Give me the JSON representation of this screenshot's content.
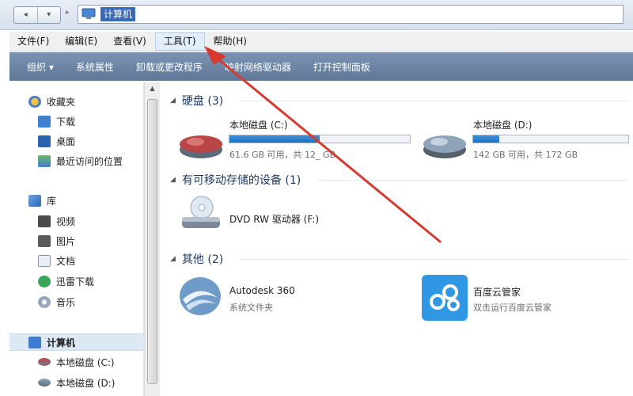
{
  "address": {
    "back_label": "◂",
    "fwd_label": "▾",
    "path": "计算机"
  },
  "menu": [
    {
      "label": "文件(F)"
    },
    {
      "label": "编辑(E)"
    },
    {
      "label": "查看(V)"
    },
    {
      "label": "工具(T)"
    },
    {
      "label": "帮助(H)"
    }
  ],
  "toolbar": [
    {
      "label": "组织 ▾"
    },
    {
      "label": "系统属性"
    },
    {
      "label": "卸载或更改程序"
    },
    {
      "label": "映射网络驱动器"
    },
    {
      "label": "打开控制面板"
    }
  ],
  "sidebar": {
    "favorites": {
      "label": "收藏夹",
      "items": [
        {
          "label": "下载"
        },
        {
          "label": "桌面"
        },
        {
          "label": "最近访问的位置"
        }
      ]
    },
    "libraries": {
      "label": "库",
      "items": [
        {
          "label": "视频"
        },
        {
          "label": "图片"
        },
        {
          "label": "文档"
        },
        {
          "label": "迅雷下载"
        },
        {
          "label": "音乐"
        }
      ]
    },
    "computer": {
      "label": "计算机",
      "items": [
        {
          "label": "本地磁盘 (C:)"
        },
        {
          "label": "本地磁盘 (D:)"
        }
      ]
    }
  },
  "groups": {
    "hdd": {
      "title": "硬盘 (3)",
      "drives": [
        {
          "name": "本地磁盘 (C:)",
          "free": "61.6 GB 可用，共 12_ GB",
          "usage": 0.5
        },
        {
          "name": "本地磁盘 (D:)",
          "free": "142 GB 可用，共 172 GB",
          "usage": 0.17
        }
      ]
    },
    "removable": {
      "title": "有可移动存储的设备 (1)",
      "items": [
        {
          "name": "DVD RW 驱动器 (F:)"
        }
      ]
    },
    "other": {
      "title": "其他 (2)",
      "items": [
        {
          "name": "Autodesk 360",
          "desc": "系统文件夹"
        },
        {
          "name": "百度云管家",
          "desc": "双击运行百度云管家"
        }
      ]
    }
  },
  "colors": {
    "annotation_arrow": "#d63a2f",
    "selection": "#3a69b6",
    "toolbar": "#6a82a3"
  }
}
